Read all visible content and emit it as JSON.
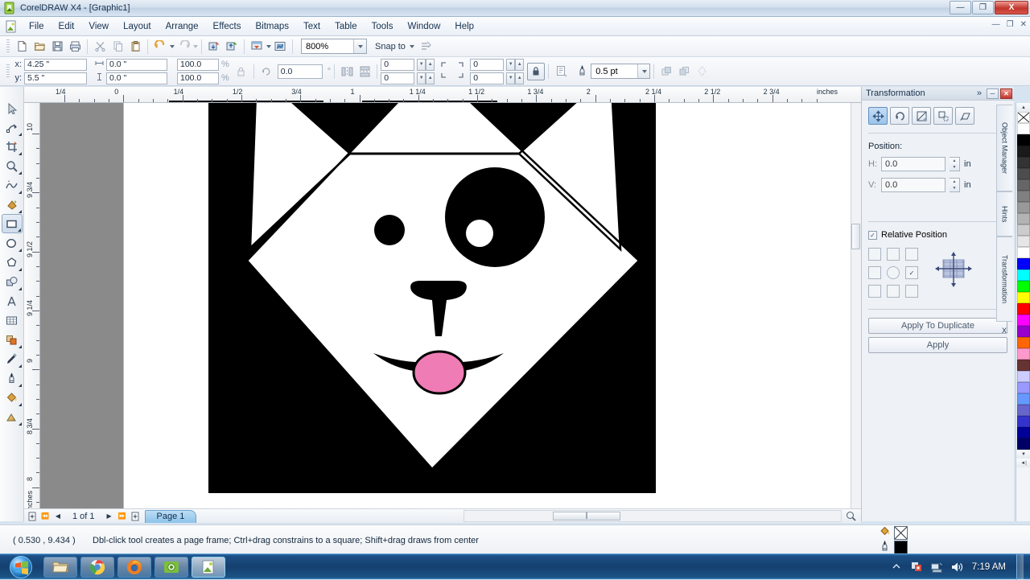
{
  "window": {
    "title": "CorelDRAW X4 - [Graphic1]",
    "icon": "coreldraw-icon",
    "minimize": "—",
    "maximize": "❐",
    "close": "X",
    "doc_minimize": "—",
    "doc_restore": "❐",
    "doc_close": "✕"
  },
  "menu": {
    "items": [
      {
        "label": "File"
      },
      {
        "label": "Edit"
      },
      {
        "label": "View"
      },
      {
        "label": "Layout"
      },
      {
        "label": "Arrange"
      },
      {
        "label": "Effects"
      },
      {
        "label": "Bitmaps"
      },
      {
        "label": "Text"
      },
      {
        "label": "Table"
      },
      {
        "label": "Tools"
      },
      {
        "label": "Window"
      },
      {
        "label": "Help"
      }
    ]
  },
  "standard_toolbar": {
    "buttons": [
      {
        "name": "new-document",
        "icon": "new-page-icon"
      },
      {
        "name": "open-document",
        "icon": "folder-open-icon"
      },
      {
        "name": "save-document",
        "icon": "floppy-disk-icon"
      },
      {
        "name": "print-document",
        "icon": "printer-icon"
      },
      {
        "name": "cut",
        "icon": "scissors-icon"
      },
      {
        "name": "copy",
        "icon": "copy-icon"
      },
      {
        "name": "paste",
        "icon": "clipboard-paste-icon"
      },
      {
        "name": "undo",
        "icon": "undo-arrow-icon"
      },
      {
        "name": "redo",
        "icon": "redo-arrow-icon"
      },
      {
        "name": "import",
        "icon": "import-icon"
      },
      {
        "name": "export",
        "icon": "export-icon"
      },
      {
        "name": "application-launcher",
        "icon": "launcher-icon"
      },
      {
        "name": "corel-online",
        "icon": "corel-online-icon"
      }
    ],
    "zoom_level": "800%",
    "snap_to_label": "Snap to",
    "options_icon": "options-icon"
  },
  "property_bar": {
    "x_label": "x:",
    "x_value": "4.25 \"",
    "y_label": "y:",
    "y_value": "5.5 \"",
    "width_value": "0.0 \"",
    "height_value": "0.0 \"",
    "scale_h": "100.0",
    "scale_v": "100.0",
    "percent": "%",
    "lock_ratio_icon": "lock-icon",
    "rotation_value": "0.0",
    "degrees": "°",
    "mirror_h_icon": "mirror-horizontal-icon",
    "mirror_v_icon": "mirror-vertical-icon",
    "corner_tl": "0",
    "corner_bl": "0",
    "corner_tr": "0",
    "corner_br": "0",
    "corner_lock_icon": "corner-lock-icon",
    "wireframe_icon": "wireframe-icon",
    "outline_icon": "outline-pen-icon",
    "outline_width": "0.5 pt",
    "to_front_icon": "to-front-icon",
    "to_back_icon": "to-back-icon",
    "contour_icon": "contour-icon"
  },
  "toolbox": {
    "tools": [
      {
        "name": "pick-tool",
        "icon": "arrow-cursor-icon",
        "selected": false,
        "flyout": false
      },
      {
        "name": "shape-tool",
        "icon": "node-edit-icon",
        "selected": false,
        "flyout": true
      },
      {
        "name": "crop-tool",
        "icon": "crop-icon",
        "selected": false,
        "flyout": true
      },
      {
        "name": "zoom-tool",
        "icon": "magnifier-icon",
        "selected": false,
        "flyout": true
      },
      {
        "name": "freehand-tool",
        "icon": "freehand-curve-icon",
        "selected": false,
        "flyout": true
      },
      {
        "name": "smart-fill-tool",
        "icon": "smart-fill-icon",
        "selected": false,
        "flyout": true
      },
      {
        "name": "rectangle-tool",
        "icon": "rectangle-icon",
        "selected": true,
        "flyout": true
      },
      {
        "name": "ellipse-tool",
        "icon": "ellipse-icon",
        "selected": false,
        "flyout": true
      },
      {
        "name": "polygon-tool",
        "icon": "polygon-icon",
        "selected": false,
        "flyout": true
      },
      {
        "name": "basic-shapes-tool",
        "icon": "basic-shapes-icon",
        "selected": false,
        "flyout": true
      },
      {
        "name": "text-tool",
        "icon": "text-a-icon",
        "selected": false,
        "flyout": false
      },
      {
        "name": "table-tool",
        "icon": "table-grid-icon",
        "selected": false,
        "flyout": false
      },
      {
        "name": "blend-tool",
        "icon": "interactive-blend-icon",
        "selected": false,
        "flyout": true
      },
      {
        "name": "eyedropper-tool",
        "icon": "eyedropper-icon",
        "selected": false,
        "flyout": true
      },
      {
        "name": "outline-tool",
        "icon": "outline-pen-icon",
        "selected": false,
        "flyout": true
      },
      {
        "name": "fill-tool",
        "icon": "paint-bucket-icon",
        "selected": false,
        "flyout": true
      },
      {
        "name": "interactive-fill-tool",
        "icon": "interactive-fill-icon",
        "selected": false,
        "flyout": true
      }
    ]
  },
  "rulers": {
    "unit": "inches",
    "horizontal_labels": [
      "1/4",
      "0",
      "1/4",
      "1/2",
      "3/4",
      "1",
      "1 1/4",
      "1 1/2",
      "1 3/4",
      "2",
      "2 1/4",
      "2 1/2",
      "2 3/4"
    ],
    "vertical_labels": [
      "10",
      "9 3/4",
      "9 1/2",
      "9 1/4",
      "9",
      "8 3/4",
      "8"
    ]
  },
  "artwork": {
    "name": "panda-face-drawing",
    "description": "Black square with white diamond panda face, one large black eye patch with white highlight, one small black eye, black nose, pink tongue",
    "colors": {
      "background": "#000000",
      "face": "#ffffff",
      "features": "#000000",
      "tongue": "#f07cb5"
    }
  },
  "docker": {
    "title": "Transformation",
    "expand_icon": "chevron-double-right-icon",
    "minimize_icon": "minimize-icon",
    "close_icon": "close-icon",
    "modes": [
      {
        "name": "position-mode",
        "icon": "move-cross-icon",
        "active": true
      },
      {
        "name": "rotate-mode",
        "icon": "rotate-icon",
        "active": false
      },
      {
        "name": "scale-mirror-mode",
        "icon": "scale-mirror-icon",
        "active": false
      },
      {
        "name": "size-mode",
        "icon": "size-icon",
        "active": false
      },
      {
        "name": "skew-mode",
        "icon": "skew-icon",
        "active": false
      }
    ],
    "position_label": "Position:",
    "h_label": "H:",
    "h_value": "0.0",
    "h_unit": "in",
    "v_label": "V:",
    "v_value": "0.0",
    "v_unit": "in",
    "relative_position_label": "Relative Position",
    "relative_position_checked": true,
    "anchor_checked_index": 5,
    "apply_to_duplicate_label": "Apply To Duplicate",
    "apply_label": "Apply"
  },
  "side_tabs": [
    {
      "label": "Object Manager",
      "icon": "object-manager-icon",
      "active": false
    },
    {
      "label": "Hints",
      "icon": "hints-icon",
      "active": false
    },
    {
      "label": "Transformation",
      "icon": "transformation-icon",
      "active": true
    },
    {
      "label": "X",
      "icon": "close-tab-icon",
      "active": false
    }
  ],
  "palette": {
    "scroll_up_icon": "scroll-up-icon",
    "scroll_down_icon": "scroll-down-icon",
    "colors": [
      "#ffffff",
      "#000000",
      "#1a1a1a",
      "#333333",
      "#4d4d4d",
      "#666666",
      "#808080",
      "#999999",
      "#b3b3b3",
      "#cccccc",
      "#e6e6e6",
      "#ffffff",
      "#0000ff",
      "#00ffff",
      "#00ff00",
      "#ffff00",
      "#ff0000",
      "#ff00ff",
      "#9900cc",
      "#ff6600",
      "#ff99cc",
      "#663333",
      "#ccccff",
      "#9999ff",
      "#6699ff",
      "#6666cc",
      "#3333cc",
      "#000099",
      "#000066"
    ]
  },
  "page_nav": {
    "add_page_start_icon": "add-page-icon",
    "first_icon": "first-page-icon",
    "prev_icon": "prev-page-icon",
    "counter": "1 of 1",
    "next_icon": "next-page-icon",
    "last_icon": "last-page-icon",
    "add_page_end_icon": "add-page-icon",
    "tab_label": "Page 1"
  },
  "status_bar": {
    "coordinates": "( 0.530 , 9.434 )",
    "hint": "Dbl-click tool creates a page frame; Ctrl+drag constrains to a square; Shift+drag draws from center",
    "fill_icon": "paint-bucket-icon",
    "fill_swatch": "none",
    "outline_icon": "outline-pen-icon",
    "outline_swatch": "#000000"
  },
  "taskbar": {
    "start_label": "start-orb",
    "items": [
      {
        "name": "windows-explorer",
        "icon": "folder-icon"
      },
      {
        "name": "google-chrome",
        "icon": "chrome-icon"
      },
      {
        "name": "mozilla-firefox",
        "icon": "firefox-icon"
      },
      {
        "name": "camtasia-recorder",
        "icon": "camera-icon"
      },
      {
        "name": "coreldraw-x4",
        "icon": "coreldraw-icon"
      }
    ],
    "tray": [
      {
        "name": "show-hidden-icons",
        "icon": "chevron-up-icon"
      },
      {
        "name": "antivirus-status",
        "icon": "shield-alert-icon"
      },
      {
        "name": "network-status",
        "icon": "network-icon"
      },
      {
        "name": "volume",
        "icon": "speaker-icon"
      }
    ],
    "clock": "7:19 AM"
  }
}
